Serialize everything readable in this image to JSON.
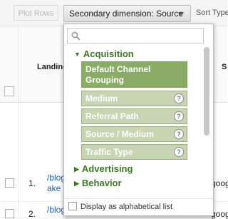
{
  "toolbar": {
    "plot_rows_label": "Plot Rows",
    "secondary_dimension_label": "Secondary dimension: Source",
    "sort_type_label": "Sort Type"
  },
  "table": {
    "landing_header": "Landing",
    "second_header": "S",
    "rows": [
      {
        "num": "1.",
        "link_line1": "/blog",
        "link_line2": "ake",
        "source": "goog"
      },
      {
        "num": "2.",
        "link_line1": "/blog",
        "link_line2": "",
        "source": "goog"
      }
    ]
  },
  "dropdown": {
    "search_placeholder": "",
    "categories": {
      "acquisition": "Acquisition",
      "advertising": "Advertising",
      "behavior": "Behavior"
    },
    "items": [
      {
        "label_line1": "Default Channel",
        "label_line2": "Grouping",
        "selected": true
      },
      {
        "label": "Medium",
        "help": "?"
      },
      {
        "label": "Referral Path",
        "help": "?"
      },
      {
        "label": "Source / Medium",
        "help": "?"
      },
      {
        "label": "Traffic Type",
        "help": "?"
      }
    ],
    "alphabetical_label": "Display as alphabetical list"
  },
  "colors": {
    "accent_green": "#3b7a25",
    "item_bg": "#c7d5b3",
    "item_selected_bg": "#8aad66",
    "link_blue": "#1a5fb4"
  },
  "icons": {
    "search": "search-icon",
    "caret": "chevron-down-icon",
    "help": "help-icon",
    "expand": "triangle-icon"
  }
}
